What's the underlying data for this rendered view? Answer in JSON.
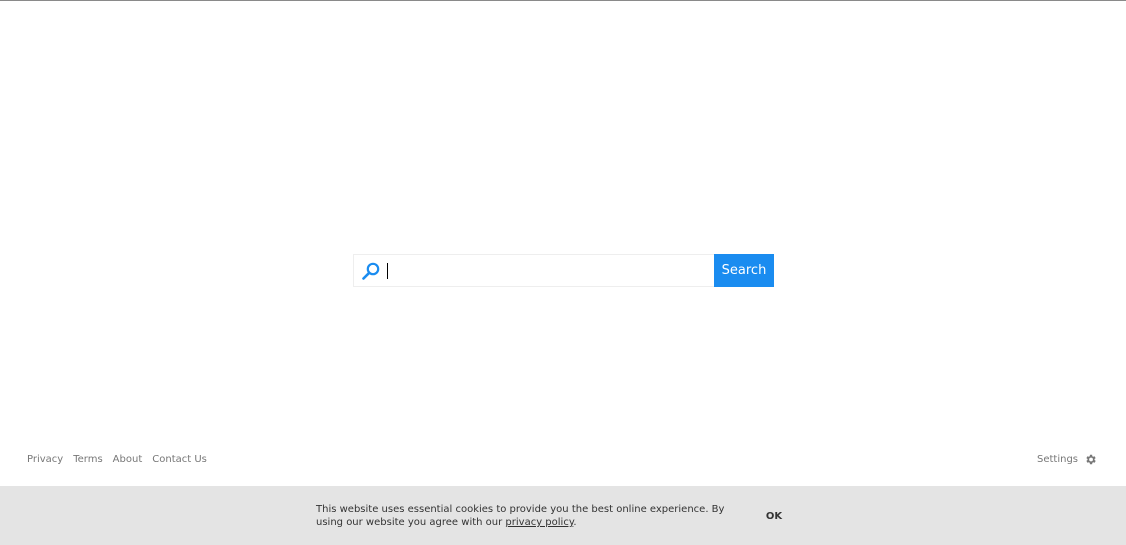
{
  "search": {
    "placeholder": "",
    "value": "",
    "button_label": "Search"
  },
  "footer": {
    "links": [
      "Privacy",
      "Terms",
      "About",
      "Contact Us"
    ],
    "settings_label": "Settings"
  },
  "cookie": {
    "text": "This website uses essential cookies to provide you the best online experience. By using our website you agree with our",
    "link_label": "privacy policy",
    "trailing": ".",
    "ok_label": "OK"
  },
  "colors": {
    "accent": "#1a8cf0",
    "cookie_bg": "#e4e4e4"
  },
  "icons": {
    "search": "search-icon",
    "settings": "gear-icon"
  }
}
